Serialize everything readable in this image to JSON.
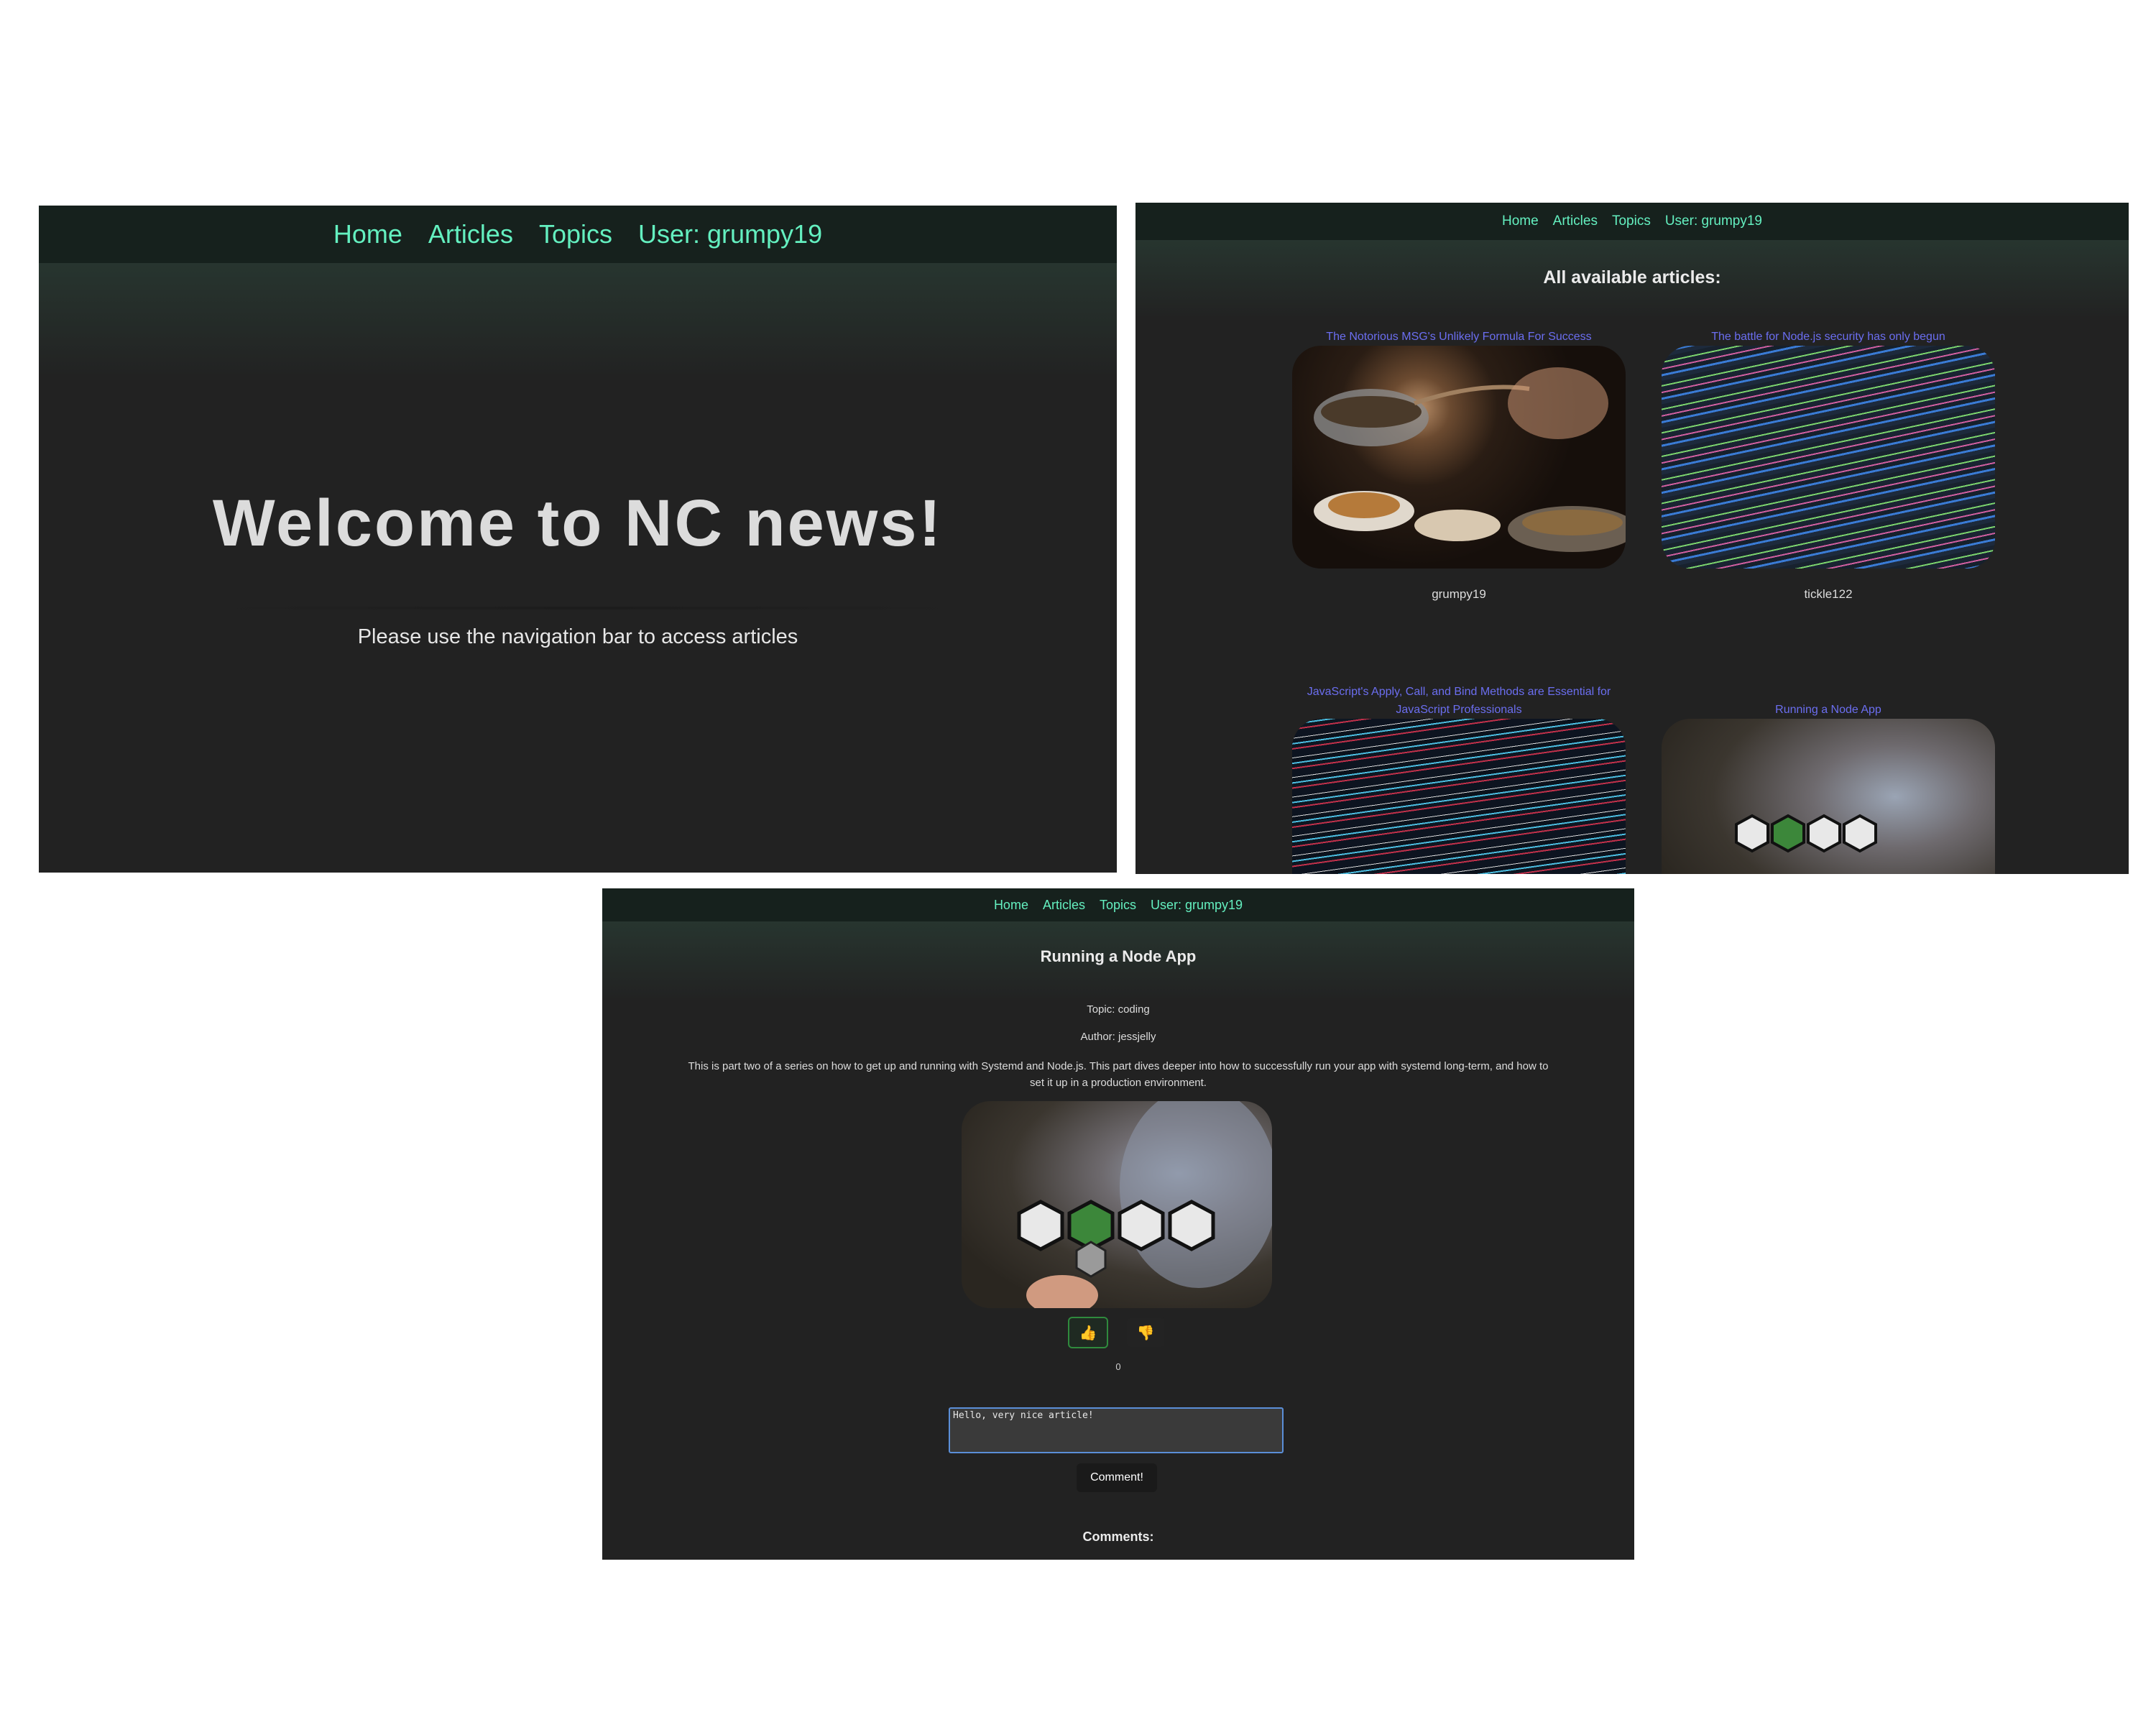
{
  "nav": {
    "home": "Home",
    "articles": "Articles",
    "topics": "Topics",
    "user": "User: grumpy19"
  },
  "home_page": {
    "heading": "Welcome to NC news!",
    "subtext": "Please use the navigation bar to access articles"
  },
  "articles_page": {
    "heading": "All available articles:",
    "articles": [
      {
        "title": "The Notorious MSG's Unlikely Formula For Success",
        "author": "grumpy19",
        "image": "cooking-photo"
      },
      {
        "title": "The battle for Node.js security has only begun",
        "author": "tickle122",
        "image": "code-screen-photo"
      },
      {
        "title": "JavaScript's Apply, Call, and Bind Methods are Essential for JavaScript Professionals",
        "author": "",
        "image": "code-screen-photo"
      },
      {
        "title": "Running a Node App",
        "author": "",
        "image": "nodejs-sticker-photo"
      }
    ]
  },
  "article_page": {
    "title": "Running a Node App",
    "topic": "Topic: coding",
    "author": "Author: jessjelly",
    "body": "This is part two of a series on how to get up and running with Systemd and Node.js. This part dives deeper into how to successfully run your app with systemd long-term, and how to set it up in a production environment.",
    "image": "nodejs-sticker-photo",
    "upvote_icon": "thumbs-up-icon",
    "downvote_icon": "thumbs-down-icon",
    "votes": "0",
    "comment_value": "Hello, very nice article!",
    "comment_button": "Comment!",
    "comments_heading": "Comments:"
  },
  "colors": {
    "nav_bg": "#16211d",
    "nav_link": "#64f0c0",
    "panel_bg": "#222222",
    "article_link": "#6b6ef0"
  }
}
